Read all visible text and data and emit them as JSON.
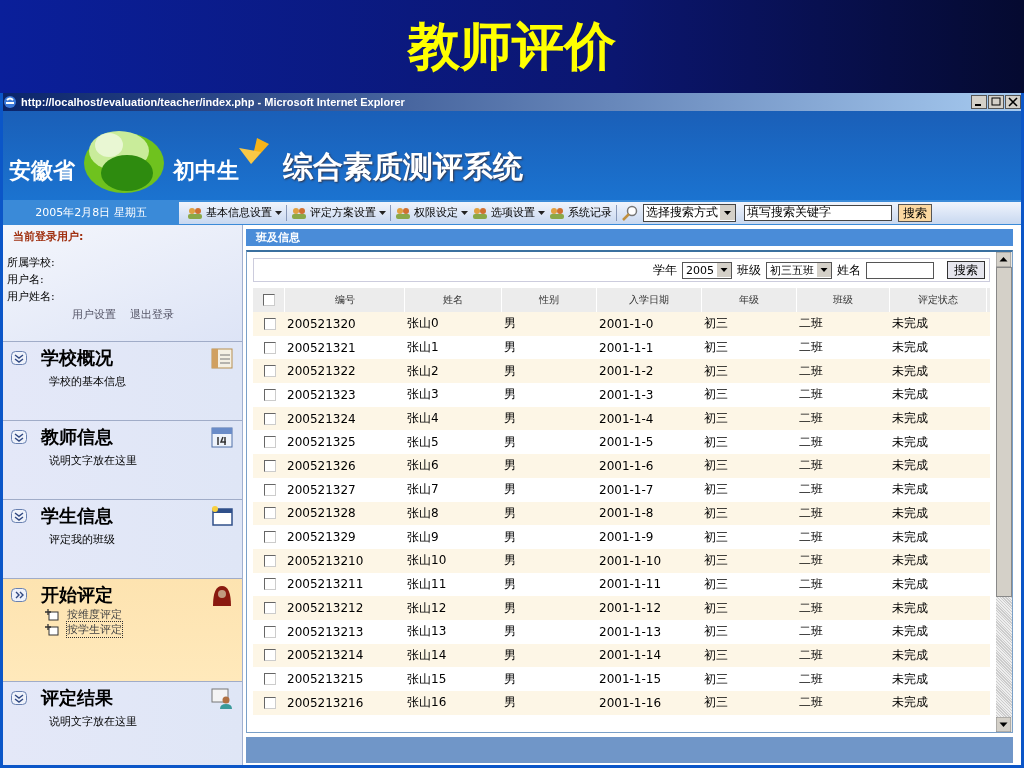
{
  "slide_title": "教师评价",
  "window": {
    "title": "http://localhost/evaluation/teacher/index.php - Microsoft Internet Explorer"
  },
  "banner": {
    "province": "安徽省",
    "level": "初中生",
    "system": "综合素质测评系统",
    "date": "2005年2月8日 星期五"
  },
  "toolbar": {
    "menus": [
      {
        "label": "基本信息设置",
        "dropdown": true
      },
      {
        "label": "评定方案设置",
        "dropdown": true
      },
      {
        "label": "权限设定",
        "dropdown": true
      },
      {
        "label": "选项设置",
        "dropdown": true
      },
      {
        "label": "系统记录",
        "dropdown": false
      }
    ],
    "search_mode": "选择搜索方式",
    "search_value": "填写搜索关键字",
    "search_button": "搜索"
  },
  "user_panel": {
    "heading": "当前登录用户:",
    "fields": [
      "所属学校:",
      "用户名:",
      "用户姓名:"
    ],
    "links": [
      "用户设置",
      "退出登录"
    ]
  },
  "sections": [
    {
      "title": "学校概况",
      "expanded": false,
      "desc": "学校的基本信息"
    },
    {
      "title": "教师信息",
      "expanded": false,
      "desc": "说明文字放在这里"
    },
    {
      "title": "学生信息",
      "expanded": false,
      "desc": "评定我的班级"
    },
    {
      "title": "开始评定",
      "expanded": true,
      "links": [
        {
          "label": "按维度评定",
          "focused": false
        },
        {
          "label": "按学生评定",
          "focused": true
        }
      ]
    },
    {
      "title": "评定结果",
      "expanded": false,
      "desc": "说明文字放在这里"
    }
  ],
  "panel": {
    "title": "班及信息"
  },
  "filter": {
    "year_label": "学年",
    "year": "2005",
    "class_label": "班级",
    "class": "初三五班",
    "name_label": "姓名",
    "button": "搜索"
  },
  "table": {
    "select_all": false,
    "columns": [
      "编号",
      "姓名",
      "性别",
      "入学日期",
      "年级",
      "班级",
      "评定状态"
    ],
    "rows": [
      {
        "checked": false,
        "cells": [
          "200521320",
          "张山0",
          "男",
          "2001-1-0",
          "初三",
          "二班",
          "未完成"
        ]
      },
      {
        "checked": false,
        "cells": [
          "200521321",
          "张山1",
          "男",
          "2001-1-1",
          "初三",
          "二班",
          "未完成"
        ]
      },
      {
        "checked": false,
        "cells": [
          "200521322",
          "张山2",
          "男",
          "2001-1-2",
          "初三",
          "二班",
          "未完成"
        ]
      },
      {
        "checked": false,
        "cells": [
          "200521323",
          "张山3",
          "男",
          "2001-1-3",
          "初三",
          "二班",
          "未完成"
        ]
      },
      {
        "checked": false,
        "cells": [
          "200521324",
          "张山4",
          "男",
          "2001-1-4",
          "初三",
          "二班",
          "未完成"
        ]
      },
      {
        "checked": false,
        "cells": [
          "200521325",
          "张山5",
          "男",
          "2001-1-5",
          "初三",
          "二班",
          "未完成"
        ]
      },
      {
        "checked": false,
        "cells": [
          "200521326",
          "张山6",
          "男",
          "2001-1-6",
          "初三",
          "二班",
          "未完成"
        ]
      },
      {
        "checked": false,
        "cells": [
          "200521327",
          "张山7",
          "男",
          "2001-1-7",
          "初三",
          "二班",
          "未完成"
        ]
      },
      {
        "checked": false,
        "cells": [
          "200521328",
          "张山8",
          "男",
          "2001-1-8",
          "初三",
          "二班",
          "未完成"
        ]
      },
      {
        "checked": false,
        "cells": [
          "200521329",
          "张山9",
          "男",
          "2001-1-9",
          "初三",
          "二班",
          "未完成"
        ]
      },
      {
        "checked": false,
        "cells": [
          "2005213210",
          "张山10",
          "男",
          "2001-1-10",
          "初三",
          "二班",
          "未完成"
        ]
      },
      {
        "checked": false,
        "cells": [
          "2005213211",
          "张山11",
          "男",
          "2001-1-11",
          "初三",
          "二班",
          "未完成"
        ]
      },
      {
        "checked": false,
        "cells": [
          "2005213212",
          "张山12",
          "男",
          "2001-1-12",
          "初三",
          "二班",
          "未完成"
        ]
      },
      {
        "checked": false,
        "cells": [
          "2005213213",
          "张山13",
          "男",
          "2001-1-13",
          "初三",
          "二班",
          "未完成"
        ]
      },
      {
        "checked": false,
        "cells": [
          "2005213214",
          "张山14",
          "男",
          "2001-1-14",
          "初三",
          "二班",
          "未完成"
        ]
      },
      {
        "checked": false,
        "cells": [
          "2005213215",
          "张山15",
          "男",
          "2001-1-15",
          "初三",
          "二班",
          "未完成"
        ]
      },
      {
        "checked": false,
        "cells": [
          "2005213216",
          "张山16",
          "男",
          "2001-1-16",
          "初三",
          "二班",
          "未完成"
        ]
      }
    ]
  }
}
